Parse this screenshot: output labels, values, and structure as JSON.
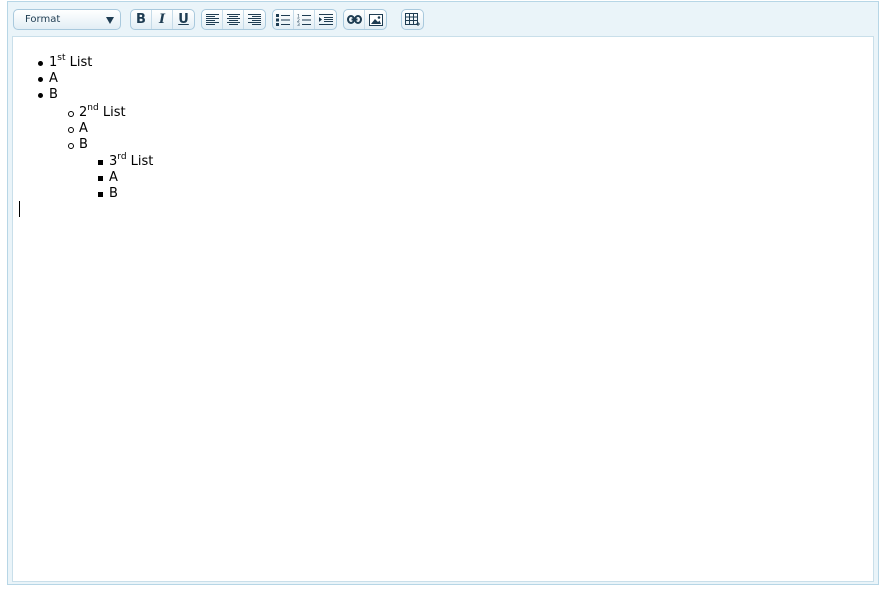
{
  "toolbar": {
    "format_label": "Format",
    "bold_label": "B",
    "italic_label": "I",
    "underline_label": "U",
    "icons": [
      "chevron-down-icon",
      "align-left-icon",
      "align-center-icon",
      "align-right-icon",
      "bullet-list-icon",
      "numbered-list-icon",
      "indent-icon",
      "link-icon",
      "image-icon",
      "table-icon"
    ]
  },
  "content": {
    "list1": {
      "heading_num": "1",
      "heading_sup": "st",
      "heading_text": " List",
      "items": [
        "A",
        "B"
      ]
    },
    "list2": {
      "heading_num": "2",
      "heading_sup": "nd",
      "heading_text": " List",
      "items": [
        "A",
        "B"
      ]
    },
    "list3": {
      "heading_num": "3",
      "heading_sup": "rd",
      "heading_text": " List",
      "items": [
        "A",
        "B"
      ]
    }
  },
  "colors": {
    "chrome_bg": "#eaf4f9",
    "border": "#b7d6e6",
    "icon": "#1e3c52"
  }
}
